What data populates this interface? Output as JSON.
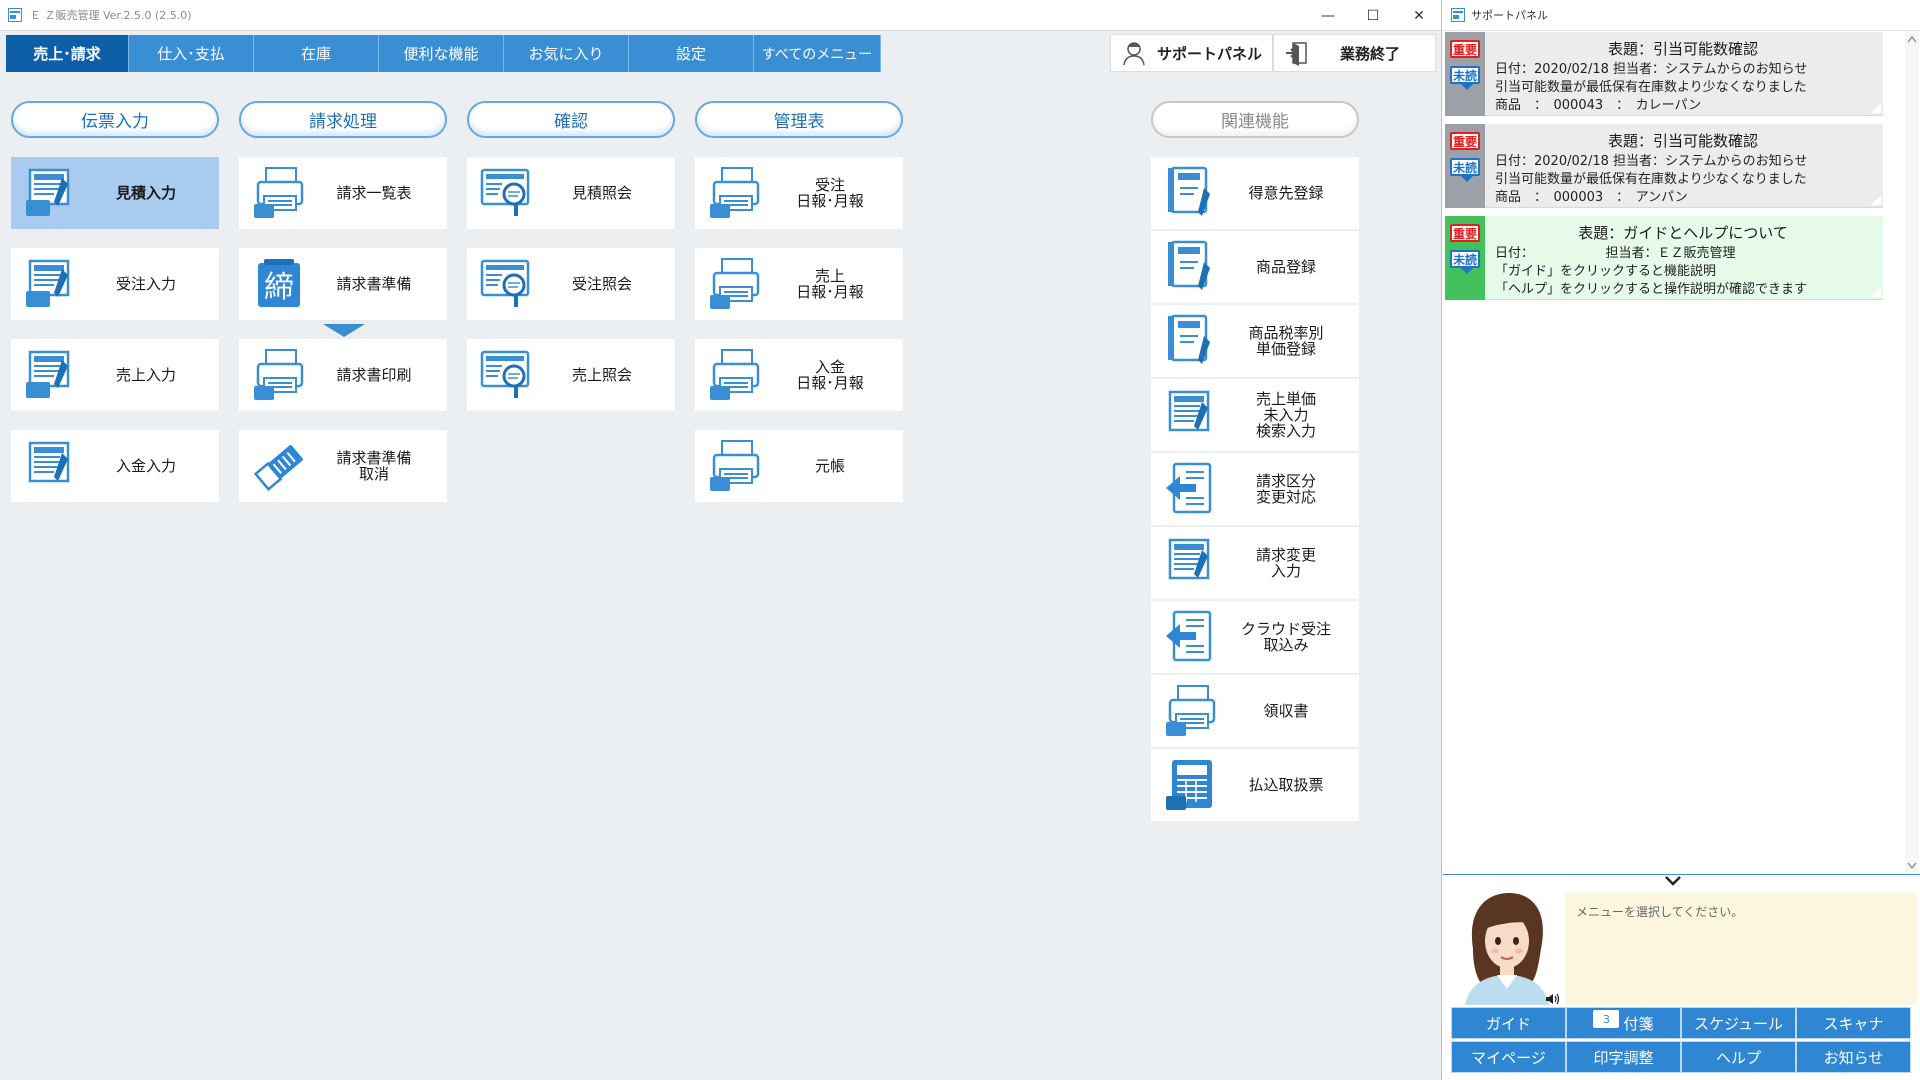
{
  "window": {
    "title": "Ｅ Ｚ販売管理 Ver.2.5.0 (2.5.0)",
    "controls": {
      "minimize": "—",
      "maximize": "☐",
      "close": "✕"
    }
  },
  "tabs": [
    {
      "label": "売上･請求"
    },
    {
      "label": "仕入･支払"
    },
    {
      "label": "在庫"
    },
    {
      "label": "便利な機能"
    },
    {
      "label": "お気に入り"
    },
    {
      "label": "設定"
    },
    {
      "label": "すべてのメニュー"
    }
  ],
  "toolbar": {
    "support_panel": "サポートパネル",
    "end_work": "業務終了"
  },
  "sections": {
    "voucher": "伝票入力",
    "billing": "請求処理",
    "confirm": "確認",
    "management": "管理表",
    "related": "関連機能"
  },
  "tiles": {
    "estimate_input": "見積入力",
    "order_input": "受注入力",
    "sales_input": "売上入力",
    "payment_input": "入金入力",
    "invoice_list": "請求一覧表",
    "invoice_prep": "請求書準備",
    "invoice_print": "請求書印刷",
    "invoice_prep_cancel": "請求書準備\n取消",
    "estimate_inquiry": "見積照会",
    "order_inquiry": "受注照会",
    "sales_inquiry": "売上照会",
    "order_report": "受注\n日報･月報",
    "sales_report": "売上\n日報･月報",
    "payment_report": "入金\n日報･月報",
    "ledger": "元帳"
  },
  "related": [
    {
      "label": "得意先登録"
    },
    {
      "label": "商品登録"
    },
    {
      "label": "商品税率別\n単価登録"
    },
    {
      "label": "売上単価\n未入力\n検索入力"
    },
    {
      "label": "請求区分\n変更対応"
    },
    {
      "label": "請求変更\n入力"
    },
    {
      "label": "クラウド受注\n取込み"
    },
    {
      "label": "領収書"
    },
    {
      "label": "払込取扱票"
    }
  ],
  "support_panel": {
    "title": "サポートパネル",
    "badge_important": "重要",
    "badge_unread": "未読",
    "notices": [
      {
        "title": "表題：引当可能数確認",
        "line1": "日付：2020/02/18 担当者：システムからのお知らせ",
        "line2": "引当可能数量が最低保有在庫数より少なくなりました",
        "line3": "商品　：　000043　：　カレーパン"
      },
      {
        "title": "表題：引当可能数確認",
        "line1": "日付：2020/02/18 担当者：システムからのお知らせ",
        "line2": "引当可能数量が最低保有在庫数より少なくなりました",
        "line3": "商品　：　000003　：　アンパン"
      },
      {
        "title": "表題：ガイドとヘルプについて",
        "line1": "日付：　　　　　　担当者：ＥＺ販売管理",
        "line2": "「ガイド」をクリックすると機能説明",
        "line3": "「ヘルプ」をクリックすると操作説明が確認できます"
      }
    ],
    "assistant_message": "メニューを選択してください。",
    "buttons": {
      "guide": "ガイド",
      "sticky": "付箋",
      "sticky_count": "3",
      "schedule": "スケジュール",
      "scanner": "スキャナ",
      "mypage": "マイページ",
      "print_adjust": "印字調整",
      "help": "ヘルプ",
      "notice": "お知らせ"
    }
  },
  "colors": {
    "tab": "#3a8fd4",
    "tab_active": "#0d5fa8",
    "selected_tile": "#a9cbef",
    "important": "#e51d1d",
    "unread": "#1e73c8"
  }
}
